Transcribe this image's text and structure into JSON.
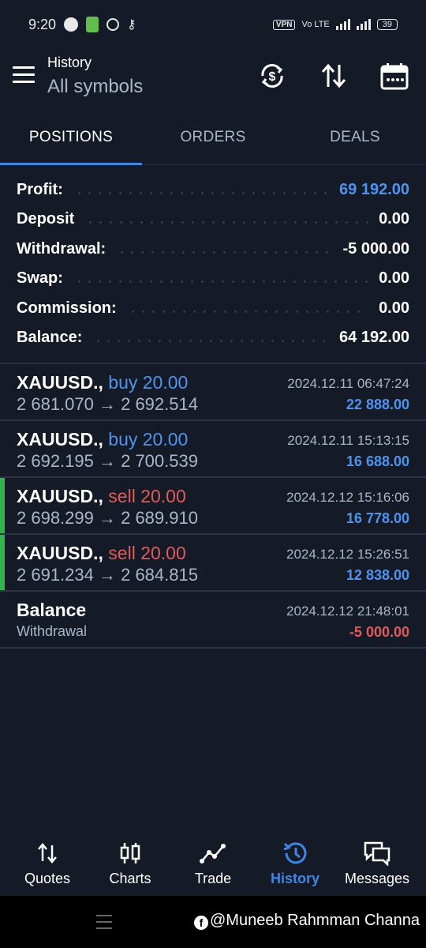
{
  "status": {
    "time": "9:20",
    "vpn": "VPN",
    "network": "Vo LTE",
    "battery": "39"
  },
  "header": {
    "title": "History",
    "subtitle": "All symbols"
  },
  "tabs": [
    {
      "label": "POSITIONS",
      "active": true
    },
    {
      "label": "ORDERS",
      "active": false
    },
    {
      "label": "DEALS",
      "active": false
    }
  ],
  "summary": [
    {
      "label": "Profit:",
      "value": "69 192.00",
      "color": "#4f93f0"
    },
    {
      "label": "Deposit",
      "value": "0.00"
    },
    {
      "label": "Withdrawal:",
      "value": "-5 000.00"
    },
    {
      "label": "Swap:",
      "value": "0.00"
    },
    {
      "label": "Commission:",
      "value": "0.00"
    },
    {
      "label": "Balance:",
      "value": "64 192.00"
    }
  ],
  "deals": [
    {
      "symbol": "XAUUSD.,",
      "side": "buy 20.00",
      "prices": "2 681.070 → 2 692.514",
      "time": "2024.12.11 06:47:24",
      "profit": "22 888.00",
      "marker": false
    },
    {
      "symbol": "XAUUSD.,",
      "side": "buy 20.00",
      "prices": "2 692.195 → 2 700.539",
      "time": "2024.12.11 15:13:15",
      "profit": "16 688.00",
      "marker": false
    },
    {
      "symbol": "XAUUSD.,",
      "side": "sell 20.00",
      "prices": "2 698.299 → 2 689.910",
      "time": "2024.12.12 15:16:06",
      "profit": "16 778.00",
      "marker": true
    },
    {
      "symbol": "XAUUSD.,",
      "side": "sell 20.00",
      "prices": "2 691.234 → 2 684.815",
      "time": "2024.12.12 15:26:51",
      "profit": "12 838.00",
      "marker": true
    }
  ],
  "balance_op": {
    "title": "Balance",
    "subtitle": "Withdrawal",
    "time": "2024.12.12 21:48:01",
    "amount": "-5 000.00"
  },
  "nav": [
    {
      "label": "Quotes",
      "icon": "arrows-updown-icon",
      "active": false
    },
    {
      "label": "Charts",
      "icon": "candlestick-icon",
      "active": false
    },
    {
      "label": "Trade",
      "icon": "trend-line-icon",
      "active": false
    },
    {
      "label": "History",
      "icon": "history-clock-icon",
      "active": true
    },
    {
      "label": "Messages",
      "icon": "chat-bubbles-icon",
      "active": false
    }
  ],
  "watermark": "@Muneeb Rahmman Channa",
  "colors": {
    "background": "#141b26",
    "accent": "#3d86e6",
    "profit_blue": "#4f93f0",
    "loss_red": "#e25a5a",
    "sell_red": "#e25a5a",
    "marker_green": "#32b34c",
    "muted": "#a9b6c8"
  }
}
